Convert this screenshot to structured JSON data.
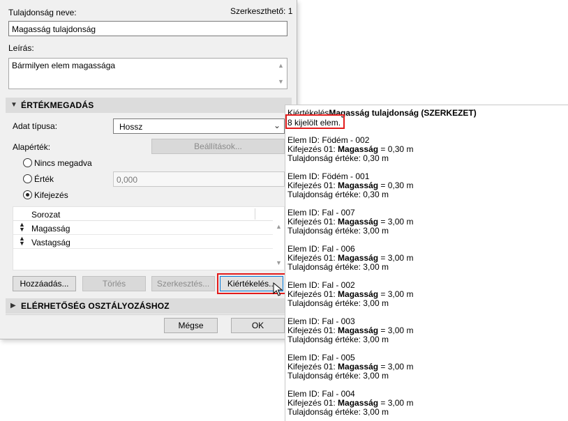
{
  "dialog": {
    "property_name_label": "Tulajdonság neve:",
    "editable_label": "Szerkeszthető: 1",
    "property_name_value": "Magasság tulajdonság",
    "description_label": "Leírás:",
    "description_value": "Bármilyen elem magassága",
    "section_values": "ÉRTÉKMEGADÁS",
    "data_type_label": "Adat típusa:",
    "data_type_value": "Hossz",
    "default_value_label": "Alapérték:",
    "settings_button": "Beállítások...",
    "radio_none": "Nincs megadva",
    "radio_value": "Érték",
    "value_field": "0,000",
    "radio_expression": "Kifejezés",
    "table_header": "Sorozat",
    "table_rows": [
      "Magasság",
      "Vastagság"
    ],
    "add_button": "Hozzáadás...",
    "delete_button": "Törlés",
    "edit_button": "Szerkesztés...",
    "evaluate_button": "Kiértékelés...",
    "section_availability": "ELÉRHETŐSÉG OSZTÁLYOZÁSHOZ",
    "cancel_button": "Mégse",
    "ok_button": "OK"
  },
  "panel": {
    "title_prefix": "Kiértékelés",
    "title_bold": "Magasság tulajdonság (SZERKEZET)",
    "selected_count": "8 kijelölt elem.",
    "expr_label": "Kifejezés 01: ",
    "expr_var": "Magasság",
    "items": [
      {
        "id": "Elem ID: Födém - 002",
        "result": " = 0,30 m",
        "value": "Tulajdonság értéke: 0,30 m"
      },
      {
        "id": "Elem ID: Födém - 001",
        "result": " = 0,30 m",
        "value": "Tulajdonság értéke: 0,30 m"
      },
      {
        "id": "Elem ID: Fal - 007",
        "result": " = 3,00 m",
        "value": "Tulajdonság értéke: 3,00 m"
      },
      {
        "id": "Elem ID: Fal - 006",
        "result": " = 3,00 m",
        "value": "Tulajdonság értéke: 3,00 m"
      },
      {
        "id": "Elem ID: Fal - 002",
        "result": " = 3,00 m",
        "value": "Tulajdonság értéke: 3,00 m"
      },
      {
        "id": "Elem ID: Fal - 003",
        "result": " = 3,00 m",
        "value": "Tulajdonság értéke: 3,00 m"
      },
      {
        "id": "Elem ID: Fal - 005",
        "result": " = 3,00 m",
        "value": "Tulajdonság értéke: 3,00 m"
      },
      {
        "id": "Elem ID: Fal - 004",
        "result": " = 3,00 m",
        "value": "Tulajdonság értéke: 3,00 m"
      }
    ]
  },
  "colors": {
    "highlight": "#e21b1b",
    "dialog_bg": "#f0f0f0",
    "section_bg": "#dcdcdc",
    "default_button_border": "#0078d7"
  }
}
